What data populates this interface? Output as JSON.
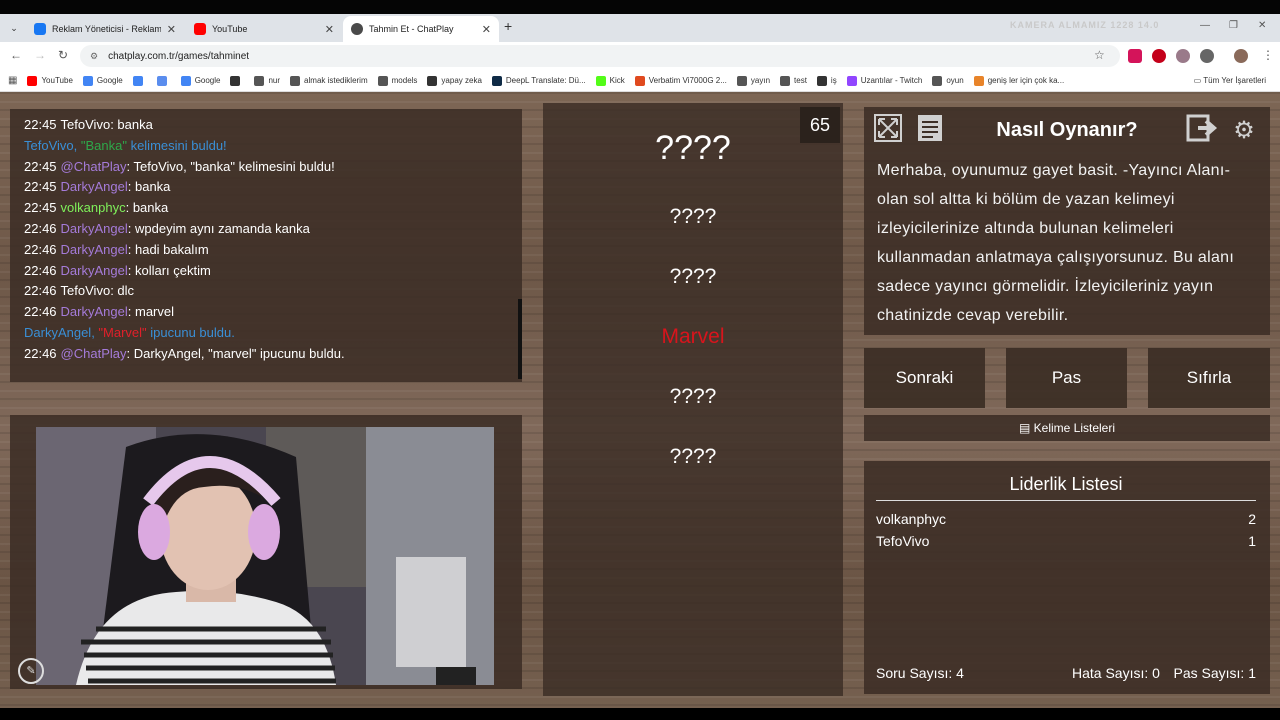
{
  "browser": {
    "tabs": [
      {
        "label": "Reklam Yöneticisi - Reklamları Y",
        "color": "#1877f2"
      },
      {
        "label": "YouTube",
        "color": "#ff0000"
      },
      {
        "label": "Tahmin Et - ChatPlay",
        "color": "#4a4a4a"
      }
    ],
    "ghost_text": "KAMERA ALMAMIZ 1228 14.0",
    "url": "chatplay.com.tr/games/tahminet",
    "bookmarks": [
      {
        "label": "YouTube",
        "color": "#ff0000"
      },
      {
        "label": "Google",
        "color": "#4285f4"
      },
      {
        "label": "",
        "color": "#4285f4"
      },
      {
        "label": "",
        "color": "#5a8dee"
      },
      {
        "label": "Google",
        "color": "#4285f4"
      },
      {
        "label": "",
        "color": "#333333"
      },
      {
        "label": "nur",
        "color": "#555555"
      },
      {
        "label": "almak istediklerim",
        "color": "#555555"
      },
      {
        "label": "models",
        "color": "#555555"
      },
      {
        "label": "yapay zeka",
        "color": "#333333"
      },
      {
        "label": "DeepL Translate: Dü...",
        "color": "#0f2b46"
      },
      {
        "label": "Kick",
        "color": "#53fc18"
      },
      {
        "label": "Verbatim Vi7000G 2...",
        "color": "#e04a1f"
      },
      {
        "label": "yayın",
        "color": "#555555"
      },
      {
        "label": "test",
        "color": "#555555"
      },
      {
        "label": "iş",
        "color": "#333333"
      },
      {
        "label": "Uzantılar - Twitch",
        "color": "#9146ff"
      },
      {
        "label": "oyun",
        "color": "#555555"
      },
      {
        "label": "geniş ler için çok ka...",
        "color": "#e8842a"
      }
    ],
    "all_bookmarks": "Tüm Yer İşaretleri"
  },
  "chat": {
    "lines": [
      {
        "time": "22:45",
        "user": "TefoVivo",
        "user_color": "#ffffff",
        "sep": ": ",
        "msg": "banka",
        "msg_color": "#ffffff"
      },
      {
        "time": "",
        "user": "TefoVivo, ",
        "user_color": "#3a8fd6",
        "sep": "",
        "msg": "\"Banka\"",
        "msg_color": "#2ea84a",
        "tail": " kelimesini buldu!",
        "tail_color": "#3a8fd6"
      },
      {
        "time": "22:45",
        "user": "@ChatPlay",
        "user_color": "#a57bd9",
        "sep": ": ",
        "msg": "TefoVivo, \"banka\" kelimesini buldu!",
        "msg_color": "#ffffff"
      },
      {
        "time": "22:45",
        "user": "DarkyAngel",
        "user_color": "#a57bd9",
        "sep": ": ",
        "msg": "banka",
        "msg_color": "#ffffff"
      },
      {
        "time": "22:45",
        "user": "volkanphyc",
        "user_color": "#7ff05a",
        "sep": ": ",
        "msg": "banka",
        "msg_color": "#ffffff"
      },
      {
        "time": "22:46",
        "user": "DarkyAngel",
        "user_color": "#a57bd9",
        "sep": ": ",
        "msg": "wpdeyim aynı zamanda kanka",
        "msg_color": "#ffffff"
      },
      {
        "time": "22:46",
        "user": "DarkyAngel",
        "user_color": "#a57bd9",
        "sep": ": ",
        "msg": "hadi bakalım",
        "msg_color": "#ffffff"
      },
      {
        "time": "22:46",
        "user": "DarkyAngel",
        "user_color": "#a57bd9",
        "sep": ": ",
        "msg": "kolları çektim",
        "msg_color": "#ffffff"
      },
      {
        "time": "22:46",
        "user": "TefoVivo",
        "user_color": "#ffffff",
        "sep": ": ",
        "msg": "dlc",
        "msg_color": "#ffffff"
      },
      {
        "time": "22:46",
        "user": "DarkyAngel",
        "user_color": "#a57bd9",
        "sep": ": ",
        "msg": "marvel",
        "msg_color": "#ffffff"
      },
      {
        "time": "",
        "user": "DarkyAngel, ",
        "user_color": "#3a8fd6",
        "sep": "",
        "msg": "\"Marvel\"",
        "msg_color": "#e0202a",
        "tail": " ipucunu buldu.",
        "tail_color": "#3a8fd6"
      },
      {
        "time": "22:46",
        "user": "@ChatPlay",
        "user_color": "#a57bd9",
        "sep": ": ",
        "msg": "DarkyAngel, \"marvel\" ipucunu buldu.",
        "msg_color": "#ffffff"
      }
    ]
  },
  "words": {
    "timer": "65",
    "main": "????",
    "hints": [
      "????",
      "????",
      "Marvel",
      "????",
      "????"
    ],
    "hint_found_color": "#d8141c"
  },
  "howto": {
    "title": "Nasıl Oynanır?",
    "text": "Merhaba, oyunumuz gayet basit. -Yayıncı Alanı- olan sol altta ki bölüm de yazan kelimeyi izleyicilerinize altında bulunan kelimeleri kullanmadan anlatmaya çalışıyorsunuz. Bu alanı sadece yayıncı görmelidir. İzleyicileriniz yayın chatinizde cevap verebilir."
  },
  "buttons": {
    "next": "Sonraki",
    "pass": "Pas",
    "reset": "Sıfırla",
    "word_lists": "Kelime Listeleri"
  },
  "leaderboard": {
    "title": "Liderlik Listesi",
    "rows": [
      {
        "name": "volkanphyc",
        "score": "2"
      },
      {
        "name": "TefoVivo",
        "score": "1"
      }
    ],
    "question_count": "Soru Sayısı: 4",
    "error_count": "Hata Sayısı: 0",
    "pass_count": "Pas Sayısı: 1"
  }
}
